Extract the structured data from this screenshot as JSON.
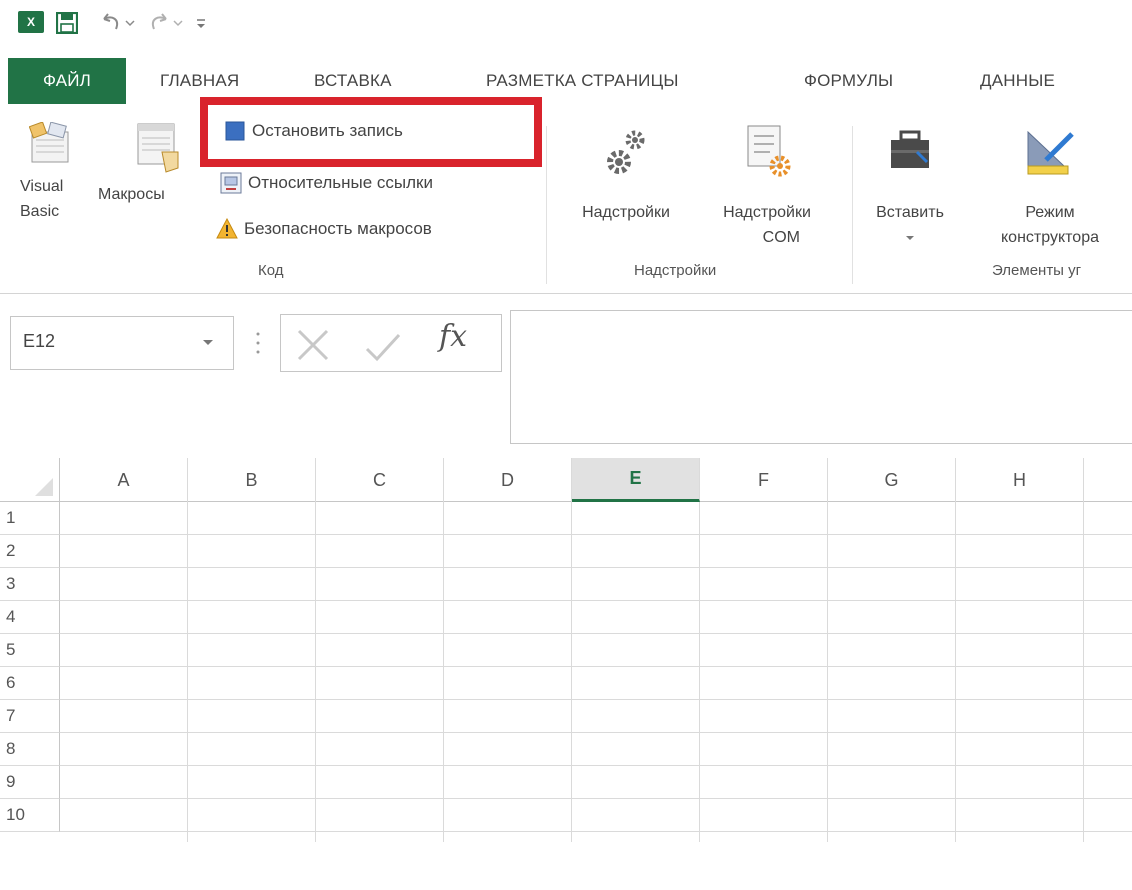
{
  "qat": {
    "excel_logo": "X",
    "icons": [
      "excel-logo",
      "save-icon",
      "undo-icon",
      "redo-icon",
      "customize-qat-icon"
    ]
  },
  "tabs": [
    {
      "label": "ФАЙЛ"
    },
    {
      "label": "ГЛАВНАЯ"
    },
    {
      "label": "ВСТАВКА"
    },
    {
      "label": "РАЗМЕТКА СТРАНИЦЫ"
    },
    {
      "label": "ФОРМУЛЫ"
    },
    {
      "label": "ДАННЫЕ"
    }
  ],
  "ribbon": {
    "code": {
      "visual_basic": "Visual Basic",
      "visual_basic_line1": "Visual",
      "visual_basic_line2": "Basic",
      "macros": "Макросы",
      "stop_recording": "Остановить запись",
      "relative_refs": "Относительные ссылки",
      "macro_security": "Безопасность макросов",
      "group_label": "Код"
    },
    "addins": {
      "addins": "Надстройки",
      "com_addins_line1": "Надстройки",
      "com_addins_line2": "COM",
      "group_label": "Надстройки"
    },
    "controls": {
      "insert": "Вставить",
      "design_line1": "Режим",
      "design_line2": "конструктора",
      "group_label": "Элементы уг"
    }
  },
  "formula_bar": {
    "name_box": "E12",
    "fx": "fx",
    "formula": ""
  },
  "sheet": {
    "columns": [
      "A",
      "B",
      "C",
      "D",
      "E",
      "F",
      "G",
      "H"
    ],
    "active_column": "E",
    "rows": [
      "1",
      "2",
      "3",
      "4",
      "5",
      "6",
      "7",
      "8",
      "9",
      "10"
    ]
  },
  "colors": {
    "accent": "#217346",
    "highlight_box": "#d9232c"
  }
}
